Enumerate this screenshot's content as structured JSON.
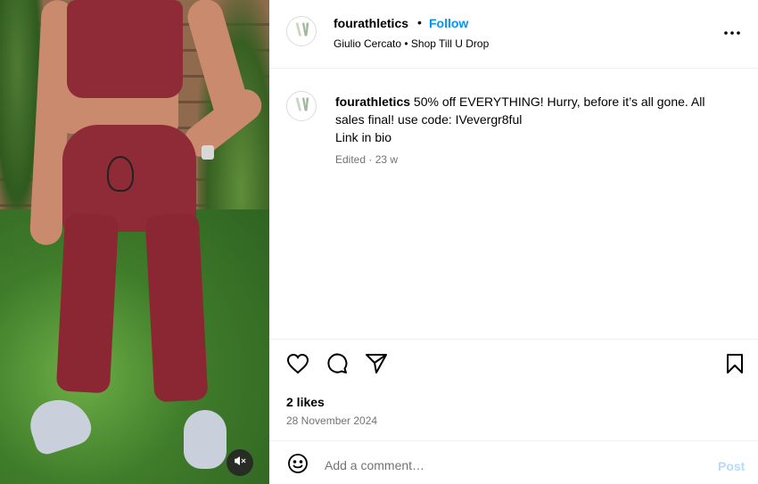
{
  "post": {
    "username": "fourathletics",
    "follow_label": "Follow",
    "dot": "•",
    "audio_line": "Giulio Cercato • Shop Till U Drop",
    "avatar_icon": "fourathletics-logo-icon",
    "more_icon": "more-options-icon"
  },
  "caption": {
    "username": "fourathletics",
    "line1": " 50% off EVERYTHING! Hurry, before it’s all gone. All sales final! use code: IVevergr8ful",
    "line2": "Link in bio",
    "meta": "Edited · 23 w"
  },
  "actions": {
    "like_icon": "heart-icon",
    "comment_icon": "comment-icon",
    "share_icon": "share-icon",
    "save_icon": "bookmark-icon",
    "likes": "2 likes",
    "date": "28 November 2024"
  },
  "comment_bar": {
    "emoji_icon": "emoji-icon",
    "placeholder": "Add a comment…",
    "post_label": "Post"
  },
  "media": {
    "mute_icon": "muted-speaker-icon"
  },
  "colors": {
    "accent": "#0095f6",
    "post_disabled": "#b3dbff",
    "secondary_text": "#737373",
    "divider": "#efefef"
  }
}
